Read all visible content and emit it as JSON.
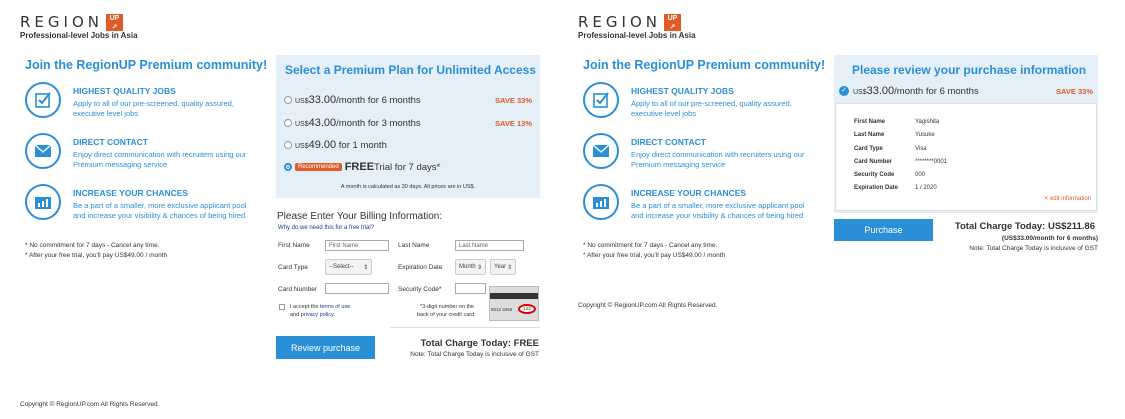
{
  "logo": {
    "word": "REGION",
    "badge": "UP",
    "tagline": "Professional-level Jobs in Asia"
  },
  "join_heading": "Join the RegionUP Premium community!",
  "features": [
    {
      "icon": "checkbox-icon",
      "title": "HIGHEST QUALITY JOBS",
      "desc_1": "Apply to all of our pre-screened, quality assured,",
      "desc_2": "executive level jobs"
    },
    {
      "icon": "envelope-icon",
      "title": "DIRECT CONTACT",
      "desc_1": "Enjoy direct communication with recruiters using our",
      "desc_2": "Premium messaging service"
    },
    {
      "icon": "bar-chart-icon",
      "title": "INCREASE YOUR CHANCES",
      "desc_1": "Be a part of a smaller, more exclusive applicant pool",
      "desc_2": "and increase your visibility & chances of being hired"
    }
  ],
  "notes": {
    "line1": "* No commitment for 7 days - Cancel any time.",
    "line2": "* After your free trial, you'll pay US$49.00 / month"
  },
  "copyright": "Copyright © RegionUP.com All Rights Reserved.",
  "plan_panel": {
    "title": "Select a Premium Plan for Unlimited Access",
    "plans": [
      {
        "currency": "US$",
        "amount": "33.00",
        "period": "/month for 6 months",
        "save": "SAVE 33%"
      },
      {
        "currency": "US$",
        "amount": "43.00",
        "period": "/month for 3 months",
        "save": "SAVE 13%"
      },
      {
        "currency": "US$",
        "amount": "49.00",
        "period": " for 1 month",
        "save": ""
      }
    ],
    "recommended_badge": "Recommended",
    "free_bold": "FREE",
    "free_rest": "Trial for 7 days*",
    "month_note": "A month is calculated as 30 days. All prices are in US$."
  },
  "billing": {
    "title": "Please Enter Your Billing Information:",
    "why_link": "Why do we need this for a free trial?",
    "first_name_label": "First Name",
    "first_name_placeholder": "First Name",
    "last_name_label": "Last Name",
    "last_name_placeholder": "Last Name",
    "card_type_label": "Card Type",
    "card_type_value": "--Select--",
    "expiration_label": "Expiration Date",
    "month_value": "Month",
    "year_value": "Year",
    "card_number_label": "Card Number",
    "security_code_label": "Security Code*",
    "terms_prefix": "I accept the ",
    "terms_link": "terms of use",
    "terms_mid": "and ",
    "privacy_link": "privacy policy",
    "terms_suffix": ".",
    "cvv_note_1": "*3-digit number on the",
    "cvv_note_2": "back of your credit card",
    "card_digits": "8012 3456",
    "card_cvv": "123",
    "review_button": "Review purchase",
    "total_label": "Total Charge Today: FREE",
    "gst_note": "Note: Total Charge Today is inclusive of GST"
  },
  "review": {
    "title": "Please review your purchase information",
    "currency": "US$",
    "amount": "33.00",
    "period": "/month for 6 months",
    "save": "SAVE 33%",
    "rows": [
      {
        "label": "First Name",
        "value": "Yagishita"
      },
      {
        "label": "Last Name",
        "value": "Yusuke"
      },
      {
        "label": "Card Type",
        "value": "Visa"
      },
      {
        "label": "Card Number",
        "value": "********0001"
      },
      {
        "label": "Security Code",
        "value": "000"
      },
      {
        "label": "Expiration Date",
        "value": "1 / 2020"
      }
    ],
    "edit_link": "< edit information",
    "purchase_button": "Purchase",
    "total": "Total Charge Today: US$211.86",
    "total_sub": "(US$33.00/month for 6 months)",
    "gst_note": "Note: Total Charge Today is inclusive of GST"
  },
  "colors": {
    "accent": "#2a8fd6",
    "brand": "#e05a2a",
    "panel": "#e4eff8"
  }
}
